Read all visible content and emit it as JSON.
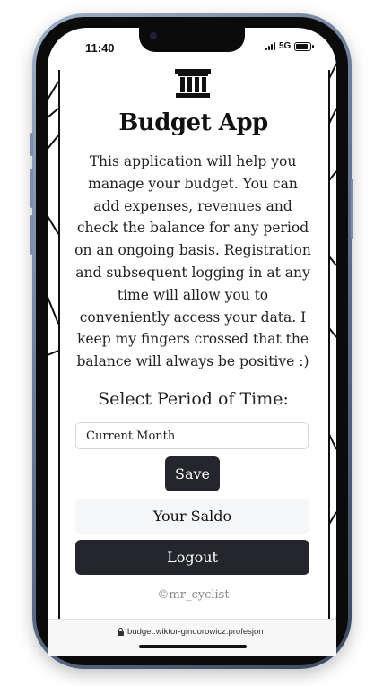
{
  "status_bar": {
    "time": "11:40",
    "network": "5G",
    "icons": [
      "signal-icon",
      "battery-icon"
    ]
  },
  "app": {
    "logo_icon": "bank-columns-icon",
    "title": "Budget App",
    "description": "This application will help you manage your budget. You can add expenses, revenues and check the balance for any period on an ongoing basis. Registration and subsequent logging in at any time will allow you to conveniently access your data. I keep my fingers crossed that the balance will always be positive :)",
    "period_label": "Select Period of Time:",
    "period_select": {
      "value": "Current Month"
    },
    "save_label": "Save",
    "saldo_label": "Your Saldo",
    "logout_label": "Logout",
    "credit": "©mr_cyclist"
  },
  "browser": {
    "url": "budget.wiktor-gindorowicz.profesjon",
    "icon": "lock-icon"
  },
  "colors": {
    "dark_button": "#24262b",
    "light_button": "#f5f6f8",
    "text": "#111111"
  }
}
